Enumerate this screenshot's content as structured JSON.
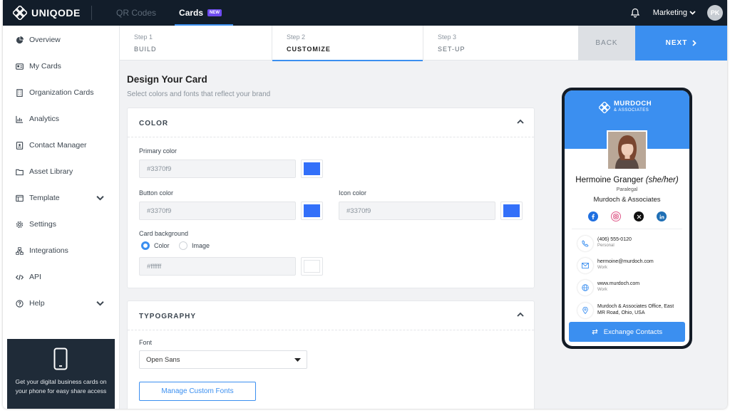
{
  "app": {
    "logo_text": "UNIQODE"
  },
  "topbar": {
    "tabs": [
      {
        "label": "QR Codes"
      },
      {
        "label": "Cards",
        "badge": "NEW"
      }
    ],
    "workspace": "Marketing",
    "avatar_initials": "PK"
  },
  "sidebar": {
    "items": [
      {
        "label": "Overview",
        "icon": "pie-chart-icon"
      },
      {
        "label": "My Cards",
        "icon": "id-card-icon"
      },
      {
        "label": "Organization Cards",
        "icon": "building-icon"
      },
      {
        "label": "Analytics",
        "icon": "bar-chart-icon"
      },
      {
        "label": "Contact Manager",
        "icon": "contact-book-icon"
      },
      {
        "label": "Asset Library",
        "icon": "folder-icon"
      },
      {
        "label": "Template",
        "icon": "template-icon"
      },
      {
        "label": "Settings",
        "icon": "gear-icon"
      },
      {
        "label": "Integrations",
        "icon": "integrations-icon"
      },
      {
        "label": "API",
        "icon": "code-icon"
      },
      {
        "label": "Help",
        "icon": "help-icon"
      }
    ],
    "promo_text": "Get your digital business cards on your phone for easy share access"
  },
  "stepper": {
    "steps": [
      {
        "number": "Step 1",
        "title": "BUILD"
      },
      {
        "number": "Step 2",
        "title": "CUSTOMIZE"
      },
      {
        "number": "Step 3",
        "title": "SET-UP"
      }
    ],
    "active_step": 2,
    "back_label": "BACK",
    "next_label": "NEXT"
  },
  "main": {
    "title": "Design Your Card",
    "subtitle": "Select colors and fonts that reflect your brand"
  },
  "color_panel": {
    "header": "COLOR",
    "primary_label": "Primary color",
    "primary_value": "#3370f9",
    "button_label": "Button color",
    "button_value": "#3370f9",
    "icon_label": "Icon color",
    "icon_value": "#3370f9",
    "background_label": "Card background",
    "background_options": [
      "Color",
      "Image"
    ],
    "background_selected": "Color",
    "background_value": "#ffffff"
  },
  "typography_panel": {
    "header": "TYPOGRAPHY",
    "font_label": "Font",
    "font_value": "Open Sans",
    "manage_fonts_label": "Manage Custom Fonts"
  },
  "preview": {
    "brand_name": "MURDOCH",
    "brand_sub": "& ASSOCIATES",
    "name": "Hermoine Granger",
    "pronouns": "(she/her)",
    "job_title": "Paralegal",
    "company": "Murdoch & Associates",
    "socials": [
      "facebook-icon",
      "instagram-icon",
      "x-icon",
      "linkedin-icon"
    ],
    "contacts": [
      {
        "value": "(406) 555-0120",
        "sub": "Personal",
        "icon": "phone-icon"
      },
      {
        "value": "hermoine@murdoch.com",
        "sub": "Work",
        "icon": "mail-icon"
      },
      {
        "value": "www.murdoch.com",
        "sub": "Work",
        "icon": "globe-icon"
      },
      {
        "value": "Murdoch & Associates Office, East MR Road, Ohio, USA",
        "sub": "",
        "icon": "location-pin-icon"
      }
    ],
    "exchange_label": "Exchange Contacts"
  },
  "colors": {
    "accent": "#3b8ff0",
    "brand_swatch": "#3370f9",
    "topbar": "#121d2a",
    "new_badge": "#6f4cf2"
  }
}
